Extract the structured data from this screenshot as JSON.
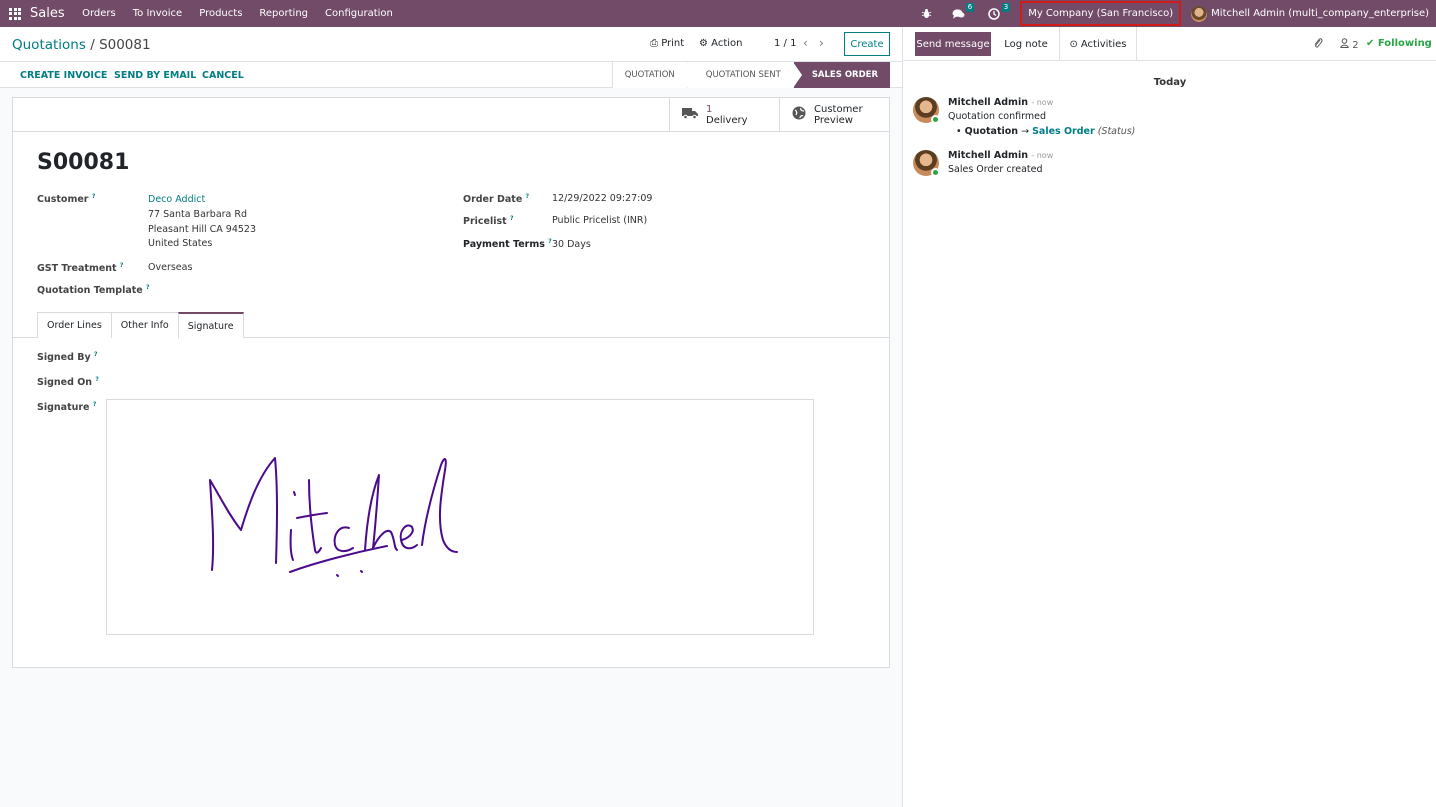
{
  "navbar": {
    "app_name": "Sales",
    "menu": [
      "Orders",
      "To Invoice",
      "Products",
      "Reporting",
      "Configuration"
    ],
    "messages_badge": "6",
    "activities_badge": "3",
    "company": "My Company (San Francisco)",
    "user": "Mitchell Admin (multi_company_enterprise)"
  },
  "breadcrumb": {
    "parent": "Quotations",
    "separator": "/",
    "current": "S00081"
  },
  "control_panel": {
    "print": "Print",
    "action": "Action",
    "pager": "1 / 1",
    "prev": "‹",
    "next": "›",
    "create": "Create"
  },
  "action_bar": {
    "buttons": [
      "CREATE INVOICE",
      "SEND BY EMAIL",
      "CANCEL"
    ],
    "stages": [
      "QUOTATION",
      "QUOTATION SENT",
      "SALES ORDER"
    ],
    "active_stage": "SALES ORDER"
  },
  "smart_buttons": {
    "delivery_count": "1",
    "delivery_label": "Delivery",
    "preview_line1": "Customer",
    "preview_line2": "Preview"
  },
  "record": {
    "name": "S00081",
    "customer_label": "Customer",
    "customer_name": "Deco Addict",
    "address_line1": "77 Santa Barbara Rd",
    "address_line2": "Pleasant Hill CA 94523",
    "address_line3": "United States",
    "gst_label": "GST Treatment",
    "gst_value": "Overseas",
    "template_label": "Quotation Template",
    "order_date_label": "Order Date",
    "order_date": "12/29/2022 09:27:09",
    "pricelist_label": "Pricelist",
    "pricelist": "Public Pricelist (INR)",
    "payment_terms_label": "Payment Terms",
    "payment_terms": "30 Days",
    "tooltip_mark": "?"
  },
  "tabs": [
    "Order Lines",
    "Other Info",
    "Signature"
  ],
  "active_tab": "Signature",
  "signature_tab": {
    "signed_by_label": "Signed By",
    "signed_on_label": "Signed On",
    "signature_label": "Signature"
  },
  "chatter": {
    "send_message": "Send message",
    "log_note": "Log note",
    "activities": "Activities",
    "followers_count": "2",
    "following": "Following",
    "day_separator": "Today",
    "messages": [
      {
        "author": "Mitchell Admin",
        "when": "- now",
        "body": "Quotation confirmed",
        "track_field": "Quotation",
        "track_arrow": "→",
        "track_new": "Sales Order",
        "track_note": "(Status)"
      },
      {
        "author": "Mitchell Admin",
        "when": "- now",
        "body": "Sales Order created"
      }
    ]
  },
  "colors": {
    "brand": "#714b67",
    "accent": "#017e84",
    "following": "#28a745",
    "signature_ink": "#4b0a8c",
    "highlight_box": "#d11a1a"
  }
}
